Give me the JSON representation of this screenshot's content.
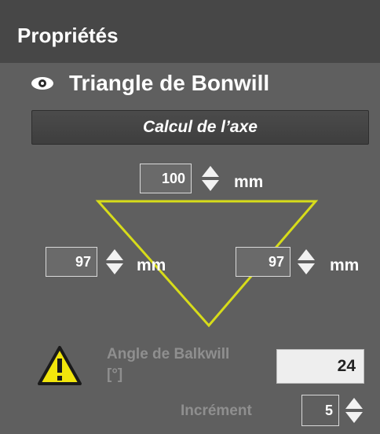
{
  "panel": {
    "title": "Propriétés",
    "section_title": "Triangle de Bonwill",
    "calc_button_label": "Calcul de l’axe",
    "top_length": {
      "value": "100",
      "unit": "mm"
    },
    "left_length": {
      "value": "97",
      "unit": "mm"
    },
    "right_length": {
      "value": "97",
      "unit": "mm"
    },
    "angle_label_line1": "Angle de Balkwill",
    "angle_label_line2": "[°]",
    "angle_value": "24",
    "increment_label": "Incrément",
    "increment_value": "5"
  },
  "colors": {
    "triangle": "#d7dc1a",
    "warning_fill": "#f2e60c",
    "background": "#5f5f5f",
    "header": "#474747"
  },
  "icons": {
    "eye": "eye-icon",
    "warning": "warning-icon",
    "spinner_up": "chevron-up-icon",
    "spinner_down": "chevron-down-icon"
  }
}
